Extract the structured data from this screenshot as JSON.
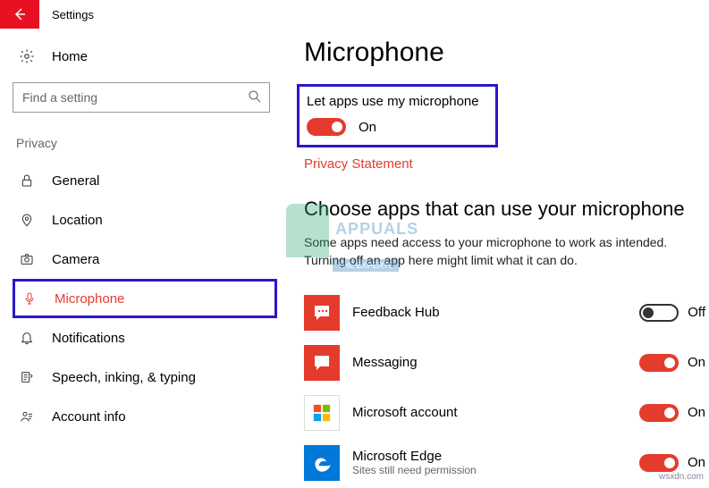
{
  "titlebar": {
    "title": "Settings"
  },
  "sidebar": {
    "home_label": "Home",
    "search_placeholder": "Find a setting",
    "group_label": "Privacy",
    "items": [
      {
        "label": "General"
      },
      {
        "label": "Location"
      },
      {
        "label": "Camera"
      },
      {
        "label": "Microphone",
        "active": true
      },
      {
        "label": "Notifications"
      },
      {
        "label": "Speech, inking, & typing"
      },
      {
        "label": "Account info"
      }
    ]
  },
  "content": {
    "heading": "Microphone",
    "toggle_section": {
      "label": "Let apps use my microphone",
      "state": "On"
    },
    "privacy_link": "Privacy Statement",
    "subheading": "Choose apps that can use your microphone",
    "description": "Some apps need access to your microphone to work as intended. Turning off an app here might limit what it can do.",
    "apps": [
      {
        "name": "Feedback Hub",
        "state": "Off",
        "on": false
      },
      {
        "name": "Messaging",
        "state": "On",
        "on": true
      },
      {
        "name": "Microsoft account",
        "state": "On",
        "on": true
      },
      {
        "name": "Microsoft Edge",
        "sub": "Sites still need permission",
        "state": "On",
        "on": true
      }
    ]
  },
  "watermark": {
    "brand": "APPUALS",
    "sub": "THE EXPERTS"
  },
  "footer": "wsxdn.com"
}
